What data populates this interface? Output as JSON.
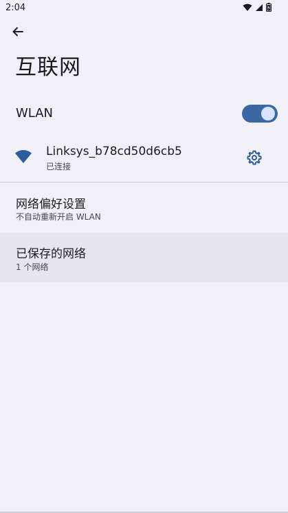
{
  "status_bar": {
    "time": "2:04",
    "icons": [
      "wifi-signal-icon",
      "cell-signal-icon",
      "battery-icon"
    ]
  },
  "header": {
    "back_icon": "arrow-back-icon",
    "title": "互联网"
  },
  "wlan": {
    "label": "WLAN",
    "enabled": true
  },
  "network": {
    "icon": "wifi-icon",
    "name": "Linksys_b78cd50d6cb5",
    "status": "已连接",
    "settings_icon": "gear-icon"
  },
  "network_preferences": {
    "title": "网络偏好设置",
    "subtitle": "不自动重新开启 WLAN"
  },
  "saved_networks": {
    "title": "已保存的网络",
    "subtitle": "1 个网络"
  },
  "colors": {
    "background": "#f1f0f6",
    "accent": "#3b67a3",
    "toggle_knob": "#d7e3ff",
    "selected_row": "#e7e6ee"
  }
}
